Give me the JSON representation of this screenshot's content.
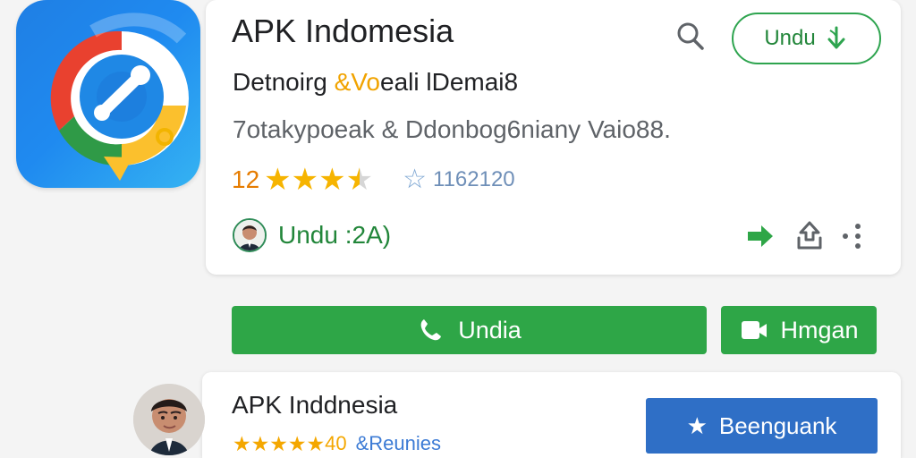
{
  "app": {
    "title": "APK Indomesia",
    "subtitle_prefix": "Detnoirg ",
    "subtitle_accent": "&Vo",
    "subtitle_suffix": "eali lDemai8",
    "meta": "7otakypoeak  &  Ddonbog6niany Vaio88.",
    "rating": "12",
    "review_count": "1162120",
    "download_label": "Undu :2A)"
  },
  "actions": {
    "top_download": "Undu",
    "primary": "Undia",
    "secondary": "Hmgan",
    "bookmark": "Beenguank"
  },
  "developer": {
    "name": "APK Inddnesia",
    "rating": "40",
    "reviews": "&Reunies"
  },
  "icons": {
    "app_icon": "compass-chat-app-icon",
    "search": "search-icon",
    "download": "download-icon",
    "phone": "phone-icon",
    "video": "video-icon",
    "forward": "forward-icon",
    "share": "share-icon",
    "more": "more-vertical-icon",
    "star": "star-icon"
  },
  "colors": {
    "green": "#2ea647",
    "blue": "#2f6fc6",
    "orange": "#e67c00",
    "gold": "#f6b400"
  }
}
